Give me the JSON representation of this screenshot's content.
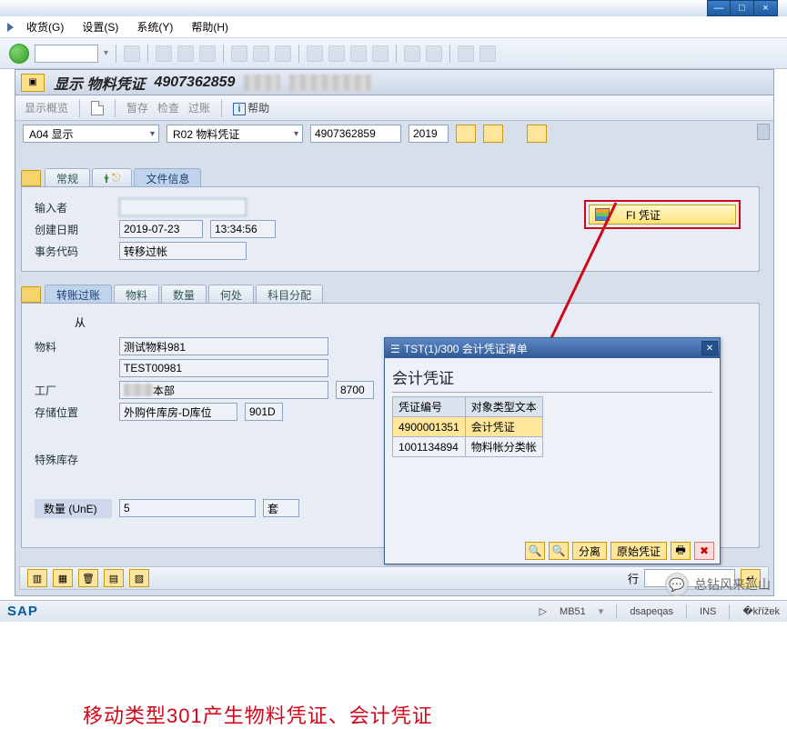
{
  "window_buttons": {
    "min": "—",
    "max": "□",
    "close": "×"
  },
  "menu": {
    "items": [
      "收货(G)",
      "设置(S)",
      "系统(Y)",
      "帮助(H)"
    ]
  },
  "title": {
    "prefix": "显示 物料凭证",
    "docnum": "4907362859"
  },
  "subtoolbar": {
    "overview": "显示概览",
    "park": "暂存",
    "check": "检查",
    "post": "过账",
    "help": "帮助"
  },
  "filter": {
    "a04": "A04 显示",
    "r02": "R02 物料凭证",
    "docnum": "4907362859",
    "year": "2019"
  },
  "tabs1": {
    "general": "常规",
    "person": "",
    "docinfo": "文件信息"
  },
  "docinfo": {
    "entered_by_label": "输入者",
    "created_label": "创建日期",
    "created_date": "2019-07-23",
    "created_time": "13:34:56",
    "tcode_label": "事务代码",
    "tcode_value": "转移过帐"
  },
  "fi_button": "FI 凭证",
  "tabs2": {
    "transfer": "转账过账",
    "material": "物料",
    "qty": "数量",
    "where": "何处",
    "acct": "科目分配"
  },
  "from_label": "从",
  "mat": {
    "material_label": "物料",
    "material_value": "测试物料981",
    "material_code": "TEST00981",
    "plant_label": "工厂",
    "plant_value": "本部",
    "plant_code": "8700",
    "sloc_label": "存储位置",
    "sloc_value": "外购件库房-D库位",
    "sloc_code": "901D",
    "special_label": "特殊库存",
    "qty_label": "数量 (UnE)",
    "qty_value": "5",
    "qty_unit": "套"
  },
  "popup": {
    "title": "TST(1)/300 会计凭证清单",
    "heading": "会计凭证",
    "col1": "凭证编号",
    "col2": "对象类型文本",
    "rows": [
      {
        "num": "4900001351",
        "type": "会计凭证"
      },
      {
        "num": "1001134894",
        "type": "物料帐分类帐"
      }
    ],
    "btn_detach": "分离",
    "btn_orig": "原始凭证"
  },
  "annotation": "移动类型301产生物料凭证、会计凭证",
  "bottom": {
    "line_label": "行"
  },
  "statusbar": {
    "sap": "SAP",
    "tx": "MB51",
    "sys": "dsapeqas",
    "ins": "INS"
  },
  "watermark": "总钻风来巡山"
}
